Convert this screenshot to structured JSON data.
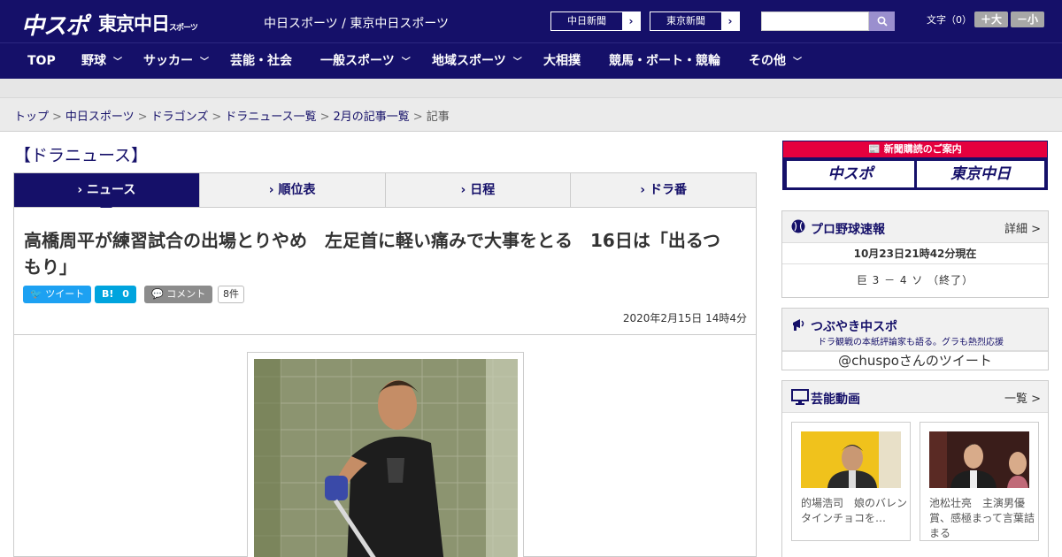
{
  "header": {
    "logo_chuspo": "中スポ",
    "logo_tokyo": "東京中日",
    "logo_tokyo_sub": "スポーツ",
    "site_title": "中日スポーツ / 東京中日スポーツ",
    "paper_links": [
      {
        "label": "中日新聞"
      },
      {
        "label": "東京新聞"
      }
    ],
    "search_placeholder": "",
    "font_size_label": "文字（0）",
    "font_plus": "＋大",
    "font_minus": "－小"
  },
  "nav": {
    "items": [
      {
        "label": "TOP",
        "dropdown": false
      },
      {
        "label": "野球",
        "dropdown": true
      },
      {
        "label": "サッカー",
        "dropdown": true
      },
      {
        "label": "芸能・社会",
        "dropdown": false
      },
      {
        "label": "一般スポーツ",
        "dropdown": true
      },
      {
        "label": "地域スポーツ",
        "dropdown": true
      },
      {
        "label": "大相撲",
        "dropdown": false
      },
      {
        "label": "競馬・ボート・競輪",
        "dropdown": false
      },
      {
        "label": "その他",
        "dropdown": true
      }
    ]
  },
  "breadcrumb": {
    "items": [
      "トップ",
      "中日スポーツ",
      "ドラゴンズ",
      "ドラニュース一覧",
      "2月の記事一覧"
    ],
    "current": "記事",
    "separator": ">"
  },
  "main": {
    "section_title": "【ドラニュース】",
    "tabs": [
      {
        "label": "ニュース",
        "active": true
      },
      {
        "label": "順位表",
        "active": false
      },
      {
        "label": "日程",
        "active": false
      },
      {
        "label": "ドラ番",
        "active": false
      }
    ],
    "article": {
      "headline": "高橋周平が練習試合の出場とりやめ　左足首に軽い痛みで大事をとる　16日は「出るつもり」",
      "share": {
        "tweet_label": "ツイート",
        "hatena_label": "B!",
        "hatena_count": "0",
        "comment_label": "コメント",
        "comment_count": "8件"
      },
      "date": "2020年2月15日 14時4分"
    }
  },
  "sidebar": {
    "subscribe": {
      "title": "新聞購読のご案内",
      "chuspo": "中スポ",
      "tokyo": "東京中日"
    },
    "baseball": {
      "title": "プロ野球速報",
      "more": "詳細 >",
      "time": "10月23日21時42分現在",
      "score": "巨 3 － 4 ソ （終了）"
    },
    "tsubuyaki": {
      "title": "つぶやき中スポ",
      "subtitle": "ドラ観戦の本紙評論家も語る。グラも熱烈応援",
      "link": "@chuspoさんのツイート"
    },
    "videos": {
      "title": "芸能動画",
      "more": "一覧 >",
      "items": [
        {
          "caption": "的場浩司　娘のバレンタインチョコを…"
        },
        {
          "caption": "池松壮亮　主演男優賞、感極まって言葉詰まる"
        }
      ]
    }
  }
}
